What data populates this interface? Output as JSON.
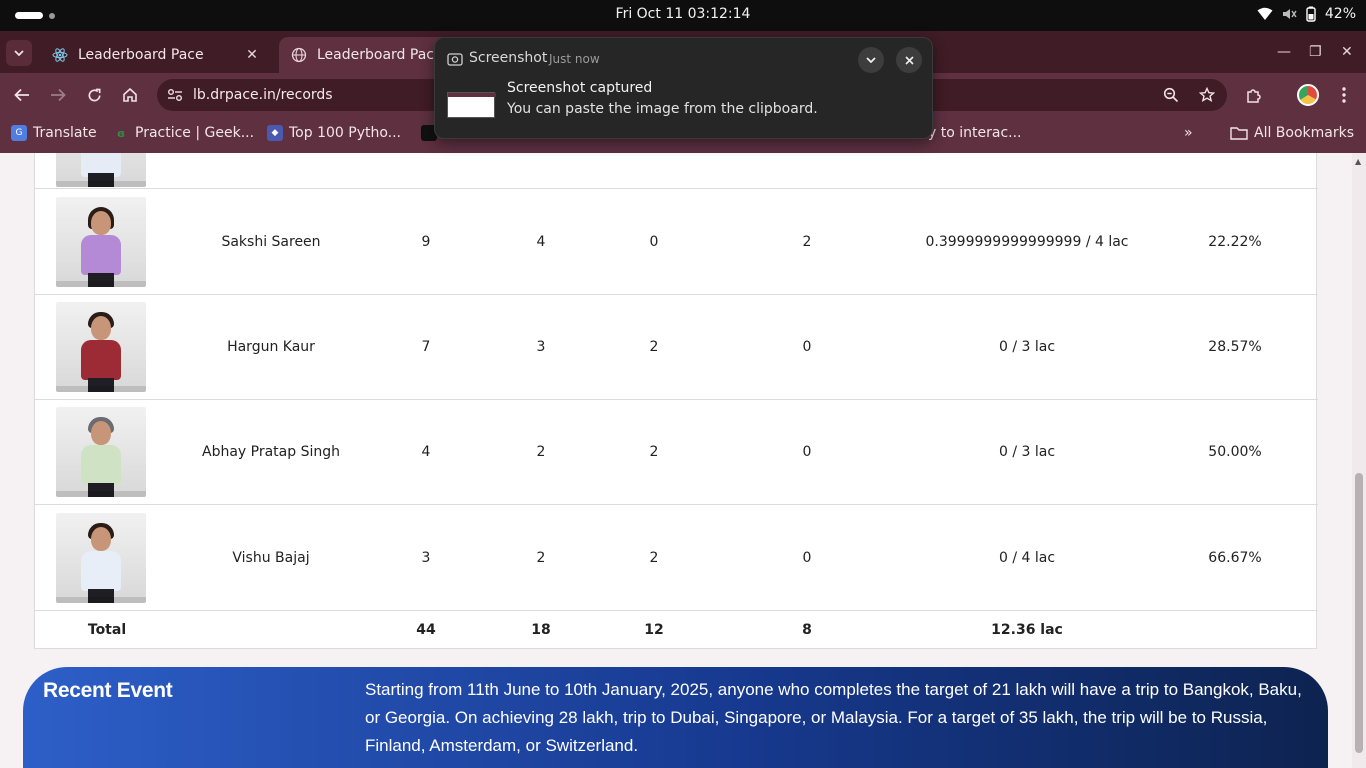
{
  "os": {
    "clock": "Fri Oct 11  03:12:14",
    "battery": "42%"
  },
  "browser": {
    "tabs": [
      {
        "title": "Leaderboard Pace",
        "active": false
      },
      {
        "title": "Leaderboard Pace",
        "active": true
      }
    ],
    "url": "lb.drpace.in/records",
    "bookmarks": [
      {
        "label": "Translate"
      },
      {
        "label": "Practice | Geek..."
      },
      {
        "label": "Top 100 Pytho..."
      },
      {
        "label": "y to interac..."
      }
    ],
    "all_bookmarks": "All Bookmarks",
    "more_bookmarks": "»"
  },
  "notification": {
    "app": "Screenshot",
    "time": "Just now",
    "heading": "Screenshot captured",
    "body": "You can paste the image from the clipboard."
  },
  "table": {
    "rows": [
      {
        "name": "Sakshi Sareen",
        "c1": "9",
        "c2": "4",
        "c3": "0",
        "c4": "2",
        "amount": "0.3999999999999999 / 4 lac",
        "pct": "22.22%",
        "shirt": "#b48ad6"
      },
      {
        "name": "Hargun Kaur",
        "c1": "7",
        "c2": "3",
        "c3": "2",
        "c4": "0",
        "amount": "0 / 3 lac",
        "pct": "28.57%",
        "shirt": "#9c2b35"
      },
      {
        "name": "Abhay Pratap Singh",
        "c1": "4",
        "c2": "2",
        "c3": "2",
        "c4": "0",
        "amount": "0 / 3 lac",
        "pct": "50.00%",
        "shirt": "#cfe3c4"
      },
      {
        "name": "Vishu Bajaj",
        "c1": "3",
        "c2": "2",
        "c3": "2",
        "c4": "0",
        "amount": "0 / 4 lac",
        "pct": "66.67%",
        "shirt": "#e8eef8"
      }
    ],
    "total": {
      "label": "Total",
      "c1": "44",
      "c2": "18",
      "c3": "12",
      "c4": "8",
      "amount": "12.36 lac"
    }
  },
  "event": {
    "title": "Recent Event",
    "text": "Starting from 11th June to 10th January, 2025, anyone who completes the target of 21 lakh will have a trip to Bangkok, Baku, or Georgia. On achieving 28 lakh, trip to Dubai, Singapore, or Malaysia. For a target of 35 lakh, the trip will be to Russia, Finland, Amsterdam, or Switzerland."
  }
}
